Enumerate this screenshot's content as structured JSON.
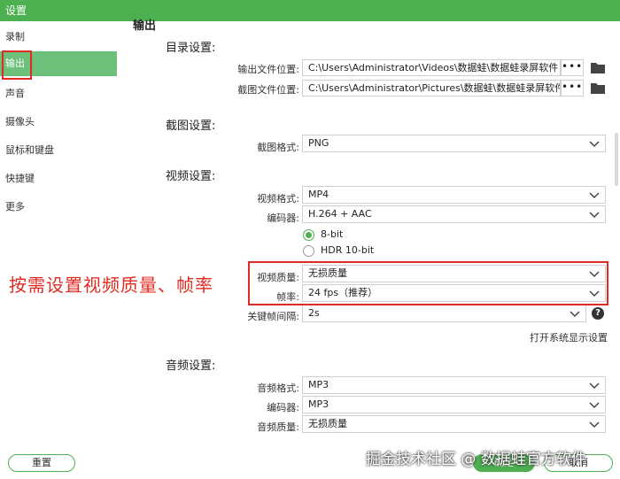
{
  "window": {
    "title": "设置"
  },
  "sidebar": {
    "items": [
      {
        "label": "录制"
      },
      {
        "label": "输出"
      },
      {
        "label": "声音"
      },
      {
        "label": "摄像头"
      },
      {
        "label": "鼠标和键盘"
      },
      {
        "label": "快捷键"
      },
      {
        "label": "更多"
      }
    ],
    "active_index": 1
  },
  "main": {
    "header_clipped": "输出",
    "directory": {
      "title": "目录设置:",
      "output_label": "输出文件位置:",
      "output_value": "C:\\Users\\Administrator\\Videos\\数据蛙\\数据蛙录屏软件",
      "screenshot_label": "截图文件位置:",
      "screenshot_value": "C:\\Users\\Administrator\\Pictures\\数据蛙\\数据蛙录屏软件",
      "browse_label": "•••"
    },
    "screenshot": {
      "title": "截图设置:",
      "format_label": "截图格式:",
      "format_value": "PNG"
    },
    "video": {
      "title": "视频设置:",
      "format_label": "视频格式:",
      "format_value": "MP4",
      "encoder_label": "编码器:",
      "encoder_value": "H.264 + AAC",
      "bit8_label": "8-bit",
      "hdr_label": "HDR 10-bit",
      "quality_label": "视频质量:",
      "quality_value": "无损质量",
      "fps_label": "帧率:",
      "fps_value": "24 fps（推荐）",
      "keyframe_label": "关键帧间隔:",
      "keyframe_value": "2s",
      "help_icon_glyph": "?",
      "display_settings_link": "打开系统显示设置"
    },
    "audio": {
      "title": "音频设置:",
      "format_label": "音频格式:",
      "format_value": "MP3",
      "encoder_label": "编码器:",
      "encoder_value": "MP3",
      "quality_label": "音频质量:",
      "quality_value": "无损质量"
    }
  },
  "annotation": {
    "text": "按需设置视频质量、帧率"
  },
  "footer": {
    "reset_label": "重置",
    "ok_label": "确定",
    "cancel_label": "取消"
  },
  "watermark": {
    "text": "掘金技术社区 @ 数据蛙官方软件"
  },
  "colors": {
    "accent": "#4caf50",
    "active_item": "#6cc07a",
    "annotation_red": "#e02b20"
  }
}
